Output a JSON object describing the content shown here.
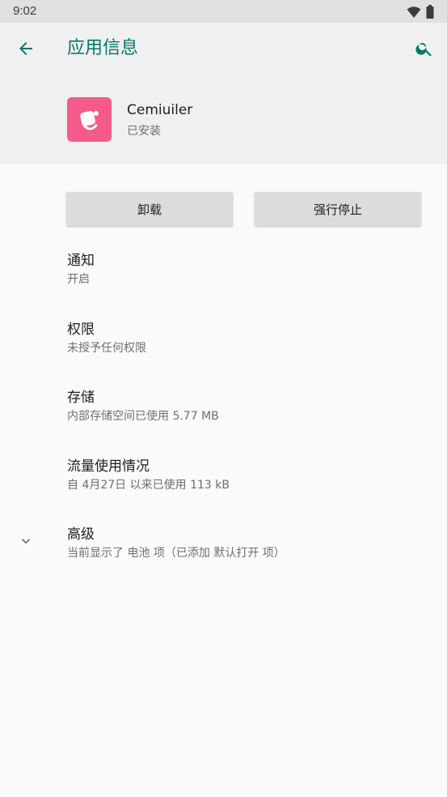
{
  "status_bar": {
    "time": "9:02"
  },
  "app_bar": {
    "title": "应用信息",
    "back_icon": "arrow-back-icon",
    "search_icon": "search-icon"
  },
  "app": {
    "name": "Cemiuiler",
    "status": "已安装",
    "icon_color": "#f45b8a"
  },
  "buttons": {
    "uninstall": "卸载",
    "force_stop": "强行停止"
  },
  "prefs": [
    {
      "title": "通知",
      "summary": "开启"
    },
    {
      "title": "权限",
      "summary": "未授予任何权限"
    },
    {
      "title": "存储",
      "summary": "内部存储空间已使用 5.77 MB"
    },
    {
      "title": "流量使用情况",
      "summary": "自 4月27日 以来已使用 113 kB"
    },
    {
      "title": "高级",
      "summary": "当前显示了 电池 项（已添加 默认打开 项）"
    }
  ],
  "colors": {
    "accent": "#00796b",
    "header_bg": "#f0f0f0",
    "page_bg": "#fafafa"
  }
}
